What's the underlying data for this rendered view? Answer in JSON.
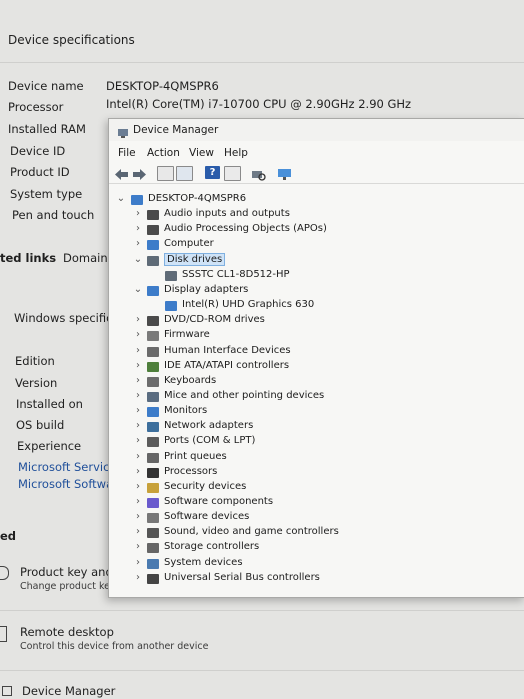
{
  "settings": {
    "section_title": "Device specifications",
    "device_specs": [
      {
        "label": "Device name",
        "value": "DESKTOP-4QMSPR6"
      },
      {
        "label": "Processor",
        "value": "Intel(R) Core(TM) i7-10700 CPU @ 2.90GHz   2.90 GHz"
      },
      {
        "label": "Installed RAM",
        "value": ""
      },
      {
        "label": "Device ID",
        "value": ""
      },
      {
        "label": "Product ID",
        "value": ""
      },
      {
        "label": "System type",
        "value": ""
      },
      {
        "label": "Pen and touch",
        "value": ""
      }
    ],
    "related_links_label": "ted links",
    "domain_link": "Domain c",
    "windows_spec_title": "Windows specificat",
    "windows_specs": [
      "Edition",
      "Version",
      "Installed on",
      "OS build",
      "Experience"
    ],
    "ms_links": [
      "Microsoft Services",
      "Microsoft Software"
    ],
    "related_label": "ed",
    "product_key_title": "Product key and ac",
    "product_key_sub": "Change product key c",
    "remote_title": "Remote desktop",
    "remote_sub": "Control this device from another device",
    "device_manager_link": "Device Manager"
  },
  "device_manager": {
    "title": "Device Manager",
    "menu": [
      "File",
      "Action",
      "View",
      "Help"
    ],
    "toolbar_icons": [
      "back-arrow-icon",
      "forward-arrow-icon",
      "properties-icon",
      "show-hidden-icon",
      "help-icon",
      "monitor-list-icon",
      "scan-hardware-icon",
      "display-icon"
    ],
    "root": "DESKTOP-4QMSPR6",
    "tree": [
      {
        "label": "Audio inputs and outputs",
        "expanded": false,
        "icon": "speaker-icon"
      },
      {
        "label": "Audio Processing Objects (APOs)",
        "expanded": false,
        "icon": "speaker-icon"
      },
      {
        "label": "Computer",
        "expanded": false,
        "icon": "computer-icon"
      },
      {
        "label": "Disk drives",
        "expanded": true,
        "selected": true,
        "icon": "disk-icon",
        "children": [
          "SSSTC CL1-8D512-HP"
        ]
      },
      {
        "label": "Display adapters",
        "expanded": true,
        "icon": "display-adapter-icon",
        "children": [
          "Intel(R) UHD Graphics 630"
        ]
      },
      {
        "label": "DVD/CD-ROM drives",
        "expanded": false,
        "icon": "dvd-icon"
      },
      {
        "label": "Firmware",
        "expanded": false,
        "icon": "firmware-icon"
      },
      {
        "label": "Human Interface Devices",
        "expanded": false,
        "icon": "hid-icon"
      },
      {
        "label": "IDE ATA/ATAPI controllers",
        "expanded": false,
        "icon": "ide-icon"
      },
      {
        "label": "Keyboards",
        "expanded": false,
        "icon": "keyboard-icon"
      },
      {
        "label": "Mice and other pointing devices",
        "expanded": false,
        "icon": "mouse-icon"
      },
      {
        "label": "Monitors",
        "expanded": false,
        "icon": "monitor-icon"
      },
      {
        "label": "Network adapters",
        "expanded": false,
        "icon": "network-icon"
      },
      {
        "label": "Ports (COM & LPT)",
        "expanded": false,
        "icon": "port-icon"
      },
      {
        "label": "Print queues",
        "expanded": false,
        "icon": "printer-icon"
      },
      {
        "label": "Processors",
        "expanded": false,
        "icon": "processor-icon"
      },
      {
        "label": "Security devices",
        "expanded": false,
        "icon": "security-icon"
      },
      {
        "label": "Software components",
        "expanded": false,
        "icon": "software-component-icon"
      },
      {
        "label": "Software devices",
        "expanded": false,
        "icon": "software-device-icon"
      },
      {
        "label": "Sound, video and game controllers",
        "expanded": false,
        "icon": "sound-icon"
      },
      {
        "label": "Storage controllers",
        "expanded": false,
        "icon": "storage-icon"
      },
      {
        "label": "System devices",
        "expanded": false,
        "icon": "system-icon"
      },
      {
        "label": "Universal Serial Bus controllers",
        "expanded": false,
        "icon": "usb-icon"
      }
    ]
  },
  "colors": {
    "link": "#1f4f9a",
    "selection_bg": "#cfe3f7",
    "selection_border": "#7fb0e0",
    "background": "#e4e4e2",
    "window_bg": "#f7f7f5"
  }
}
